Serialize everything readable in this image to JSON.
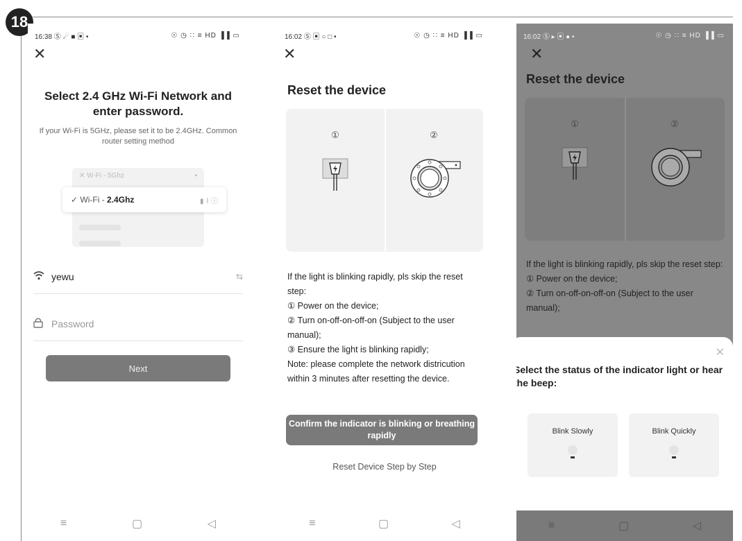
{
  "step_number": "18",
  "screen1": {
    "status_time": "16:38",
    "status_left_icons": "Ⓢ ☄ ■ ▣ •",
    "status_right_icons": "☉ ◷ ∷ ≡ HD ▐▐ ▭",
    "title": "Select 2.4 GHz Wi-Fi Network and enter password.",
    "hint": "If your Wi-Fi is 5GHz, please set it to be 2.4GHz. Common router setting method",
    "wifi_5g": "W-Fi - 5Ghz",
    "wifi_24_prefix": "Wi-Fi - ",
    "wifi_24_band": "2.4Ghz",
    "wifi_icons": "▮ ⌇ ⓘ",
    "ssid_value": "yewu",
    "password_placeholder": "Password",
    "next_label": "Next"
  },
  "screen2": {
    "status_time": "16:02",
    "status_left_icons": "Ⓢ ▣ ○ □ •",
    "status_right_icons": "☉ ◷ ∷ ≡ HD ▐▐ ▭",
    "title": "Reset the device",
    "num1": "①",
    "num2": "②",
    "desc": "If the light is blinking rapidly, pls skip the reset step:\n① Power on the device;\n② Turn on-off-on-off-on (Subject to the user manual);\n③ Ensure the light is blinking rapidly;\nNote: please complete the network districution within 3 minutes after resetting the device.",
    "confirm_label": "Confirm the indicator is blinking or breathing rapidly",
    "link_label": "Reset Device Step by Step"
  },
  "screen3": {
    "status_time": "16:02",
    "status_left_icons": "Ⓢ ▸ ▣ ● •",
    "status_right_icons": "☉ ◷ ∷ ≡ HD ▐▐ ▭",
    "title": "Reset the device",
    "num1": "①",
    "num2": "②",
    "desc": "If the light is blinking rapidly, pls skip the reset step:\n① Power on the device;\n② Turn on-off-on-off-on (Subject to the user manual);",
    "sheet_question": "Select the status of the indicator light or hear the beep:",
    "option_slow": "Blink Slowly",
    "option_quick": "Blink Quickly"
  },
  "nav": {
    "menu": "≡",
    "home": "▢",
    "back": "◁"
  }
}
